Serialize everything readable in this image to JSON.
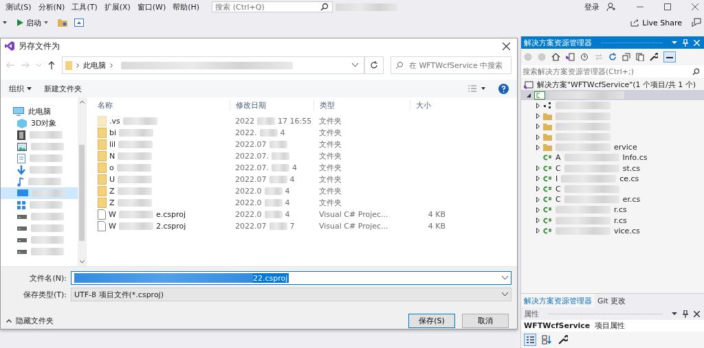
{
  "ide": {
    "menu": [
      "测试(S)",
      "分析(N)",
      "工具(T)",
      "扩展(X)",
      "窗口(W)",
      "帮助(H)"
    ],
    "search": {
      "placeholder": "搜索 (Ctrl+Q)"
    },
    "login": "登录",
    "start": "启动",
    "live_share": "Live Share"
  },
  "dialog": {
    "title": "另存文件为",
    "path": [
      "此电脑"
    ],
    "search": {
      "placeholder": "在 WFTWcfService 中搜索"
    },
    "organize": "组织",
    "new_folder": "新建文件夹",
    "nav": [
      {
        "label": "此电脑",
        "kind": "pc",
        "selected": false
      },
      {
        "label": "3D对象",
        "kind": "cube",
        "selected": false
      },
      {
        "kind": "video",
        "selected": false
      },
      {
        "kind": "image",
        "selected": false
      },
      {
        "kind": "doc",
        "selected": false
      },
      {
        "kind": "download",
        "selected": false
      },
      {
        "kind": "music",
        "selected": false
      },
      {
        "kind": "desktop",
        "selected": true
      },
      {
        "kind": "windows",
        "selected": false
      },
      {
        "kind": "drive",
        "selected": false
      },
      {
        "kind": "drive",
        "selected": false
      },
      {
        "kind": "drive",
        "selected": false
      },
      {
        "kind": "drive",
        "selected": false
      }
    ],
    "columns": [
      "名称",
      "修改日期",
      "类型",
      "大小"
    ],
    "files": [
      {
        "kind": "folder",
        "faded": true,
        "name": ".vs",
        "date": "2022",
        "date_tail": "17 16:55",
        "type": "文件夹"
      },
      {
        "kind": "folder",
        "faded": false,
        "name": "bi",
        "date": "2022.",
        "date_tail": "4",
        "type": "文件夹"
      },
      {
        "kind": "folder",
        "faded": false,
        "name": "lil",
        "date": "2022.07",
        "type": "文件夹"
      },
      {
        "kind": "folder",
        "faded": false,
        "name": "N",
        "date": "2022.07.",
        "type": "文件夹"
      },
      {
        "kind": "folder",
        "faded": false,
        "name": "o",
        "date": "2022.07.",
        "date_tail": "4",
        "type": "文件夹"
      },
      {
        "kind": "folder",
        "faded": false,
        "name": "U",
        "date": "2022.07",
        "date_tail": "4",
        "type": "文件夹"
      },
      {
        "kind": "folder",
        "faded": false,
        "name": "Z",
        "date": "2022.0",
        "date_tail": "4",
        "type": "文件夹"
      },
      {
        "kind": "folder",
        "faded": false,
        "name": "Z",
        "date": "2022.0",
        "date_tail": "4",
        "type": "文件夹"
      },
      {
        "kind": "file",
        "faded": false,
        "name": "W",
        "name_tail": "e.csproj",
        "date": "2022.0",
        "date_tail": "4",
        "type": "Visual C# Projec...",
        "size": "4 KB"
      },
      {
        "kind": "file",
        "faded": false,
        "name": "W",
        "name_tail": "2.csproj",
        "date": "2022.07",
        "date_tail": "7",
        "type": "Visual C# Projec...",
        "size": "4 KB"
      }
    ],
    "filename_label": "文件名(N):",
    "filename_tail": "22.csproj",
    "filetype_label": "保存类型(T):",
    "filetype": "UTF-8 项目文件(*.csproj)",
    "hide_folders": "隐藏文件夹",
    "save": "保存(S)",
    "cancel": "取消"
  },
  "explorer": {
    "title": "解决方案资源管理器",
    "search": {
      "placeholder": "搜索解决方案资源管理器(Ctrl+;)"
    },
    "solution": "解决方案\"WFTWcfService\"(1 个项目/共 1 个)",
    "items": [
      {
        "kind": "ref",
        "expandable": true
      },
      {
        "kind": "folder",
        "expandable": true
      },
      {
        "kind": "folder",
        "expandable": true
      },
      {
        "kind": "folder",
        "expandable": true
      },
      {
        "kind": "folder",
        "expandable": true,
        "tail": "ervice"
      },
      {
        "kind": "cs",
        "expandable": false,
        "head": "A",
        "tail": "Info.cs"
      },
      {
        "kind": "cs",
        "expandable": true,
        "head": "C",
        "tail": "st.cs"
      },
      {
        "kind": "cs",
        "expandable": true,
        "head": "I",
        "tail": "ce.cs"
      },
      {
        "kind": "cs",
        "expandable": true,
        "head": "C"
      },
      {
        "kind": "cs",
        "expandable": true,
        "head": "C",
        "tail": "er.cs"
      },
      {
        "kind": "cs",
        "expandable": true,
        "tail": "r.cs"
      },
      {
        "kind": "cs",
        "expandable": true,
        "tail": "r.cs"
      },
      {
        "kind": "cs",
        "expandable": true,
        "tail": "vice.cs"
      }
    ],
    "tabs": [
      {
        "label": "解决方案资源管理器",
        "selected": true
      },
      {
        "label": "Git 更改",
        "selected": false
      }
    ],
    "properties": {
      "title": "属性",
      "object": "WFTWcfService",
      "object_kind": "项目属性"
    }
  }
}
